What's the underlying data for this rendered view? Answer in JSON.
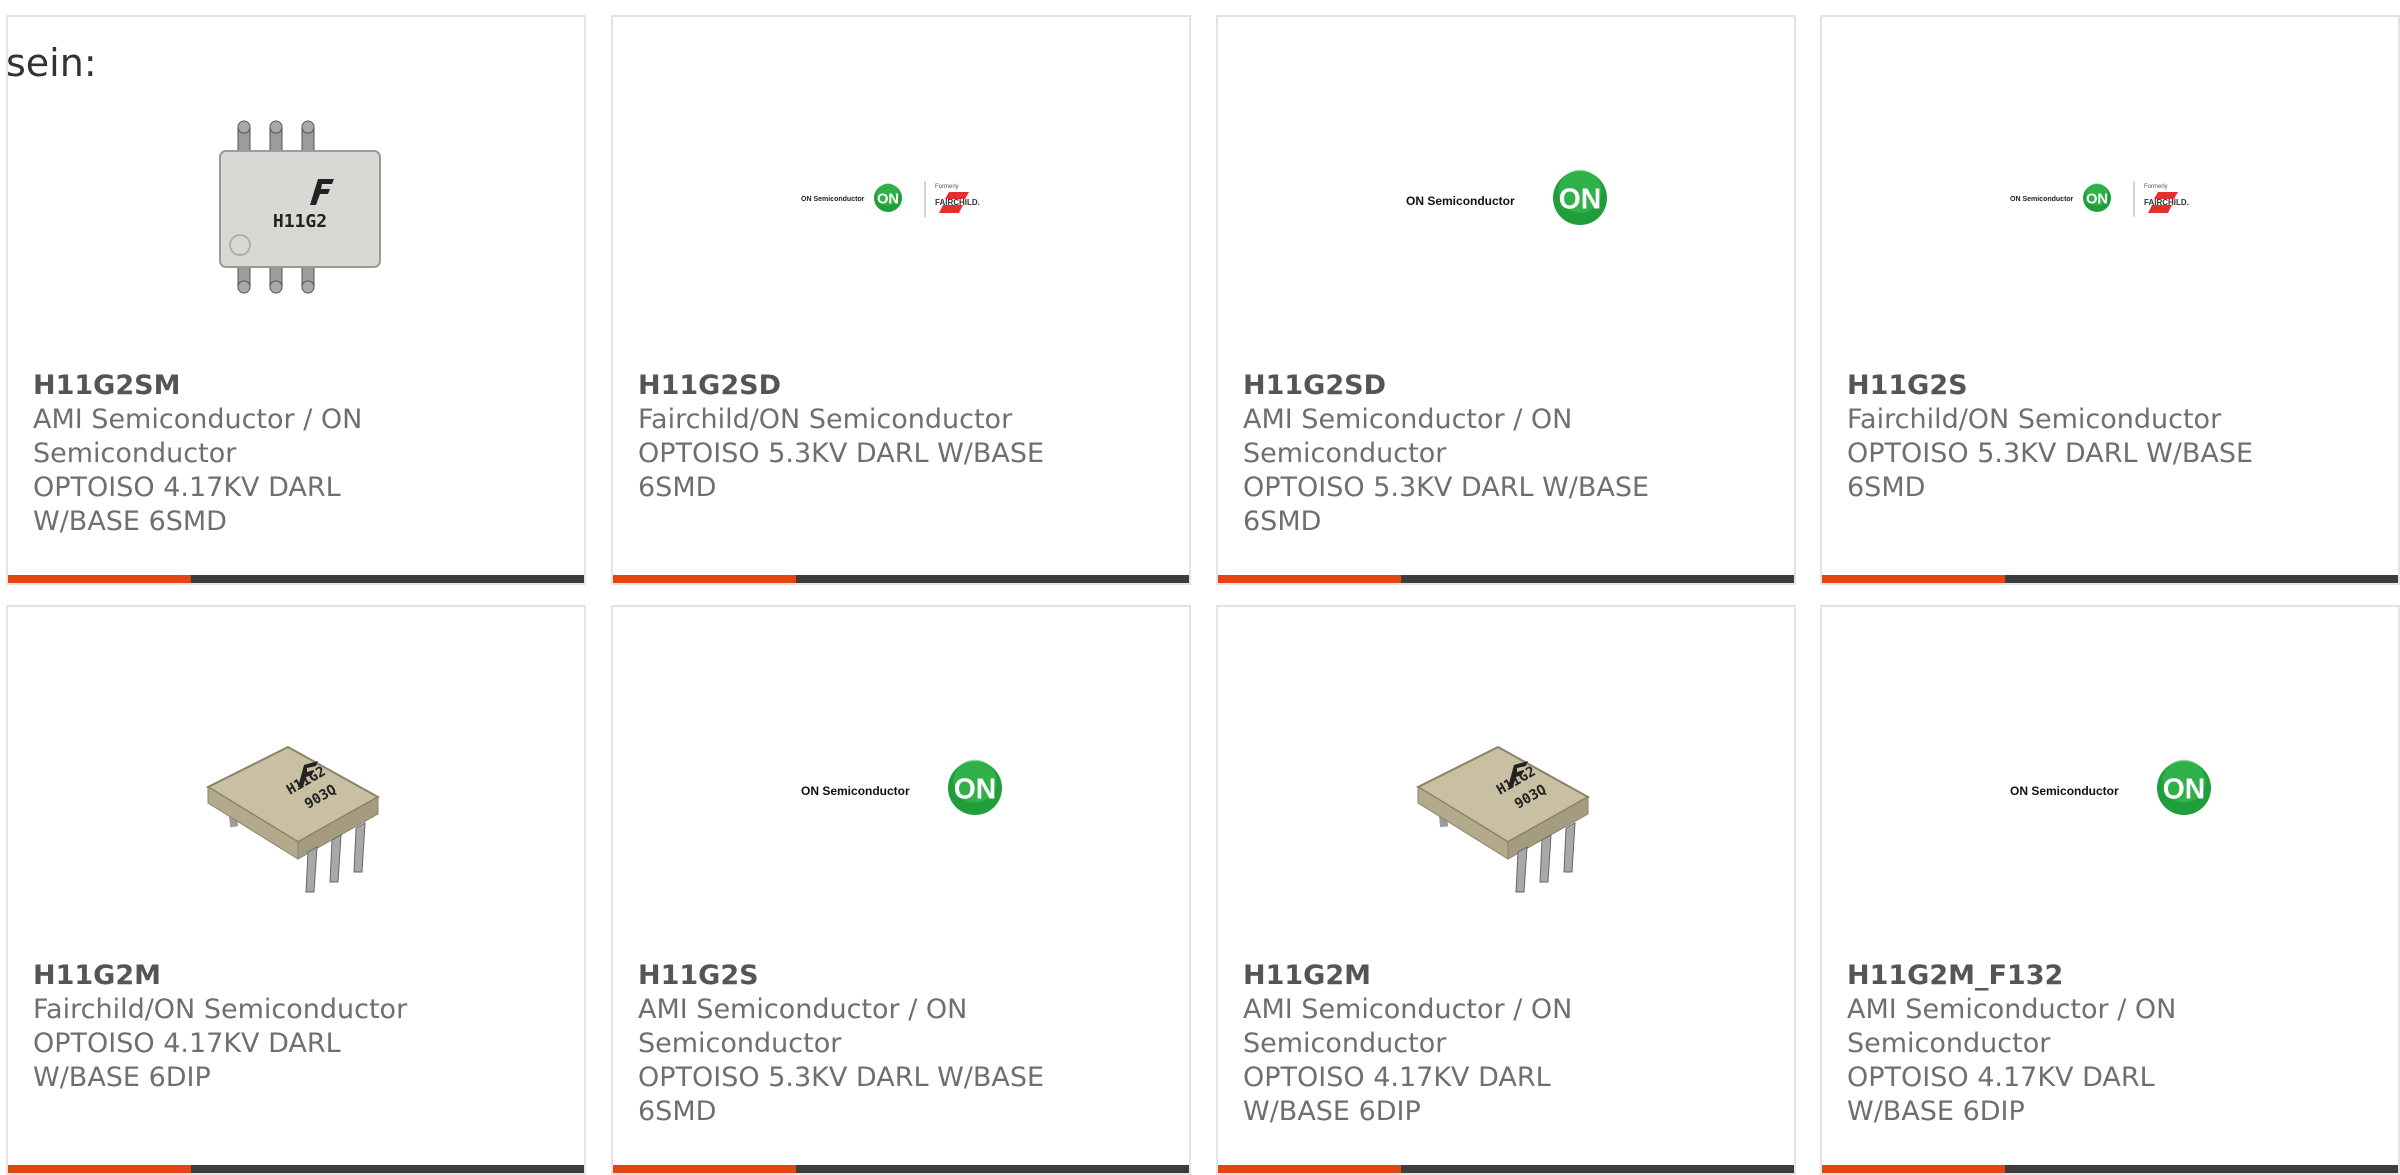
{
  "intro_text": "sein:",
  "accent_color": "#e2450d",
  "bar_color": "#3d3d3d",
  "logos": {
    "on_semi_text": "ON Semiconductor",
    "on_badge": "ON",
    "fairchild_formerly": "Formerly",
    "fairchild_text": "FAIRCHILD."
  },
  "chip_marking": {
    "smd": "H11G2",
    "dip_line1": "H11G2",
    "dip_line2": "903Q"
  },
  "cards": [
    {
      "part": "H11G2SM",
      "manufacturer": "AMI Semiconductor / ON Semiconductor",
      "description": "OPTOISO 4.17KV DARL W/BASE 6SMD",
      "image": "smd-chip"
    },
    {
      "part": "H11G2SD",
      "manufacturer": "Fairchild/ON Semiconductor",
      "description": "OPTOISO 5.3KV DARL W/BASE 6SMD",
      "image": "on-fairchild-logo"
    },
    {
      "part": "H11G2SD",
      "manufacturer": "AMI Semiconductor / ON Semiconductor",
      "description": "OPTOISO 5.3KV DARL W/BASE 6SMD",
      "image": "on-semi-logo"
    },
    {
      "part": "H11G2S",
      "manufacturer": "Fairchild/ON Semiconductor",
      "description": "OPTOISO 5.3KV DARL W/BASE 6SMD",
      "image": "on-fairchild-logo"
    },
    {
      "part": "H11G2M",
      "manufacturer": "Fairchild/ON Semiconductor",
      "description": "OPTOISO 4.17KV DARL W/BASE 6DIP",
      "image": "dip-chip"
    },
    {
      "part": "H11G2S",
      "manufacturer": "AMI Semiconductor / ON Semiconductor",
      "description": "OPTOISO 5.3KV DARL W/BASE 6SMD",
      "image": "on-semi-logo"
    },
    {
      "part": "H11G2M",
      "manufacturer": "AMI Semiconductor / ON Semiconductor",
      "description": "OPTOISO 4.17KV DARL W/BASE 6DIP",
      "image": "dip-chip"
    },
    {
      "part": "H11G2M_F132",
      "manufacturer": "AMI Semiconductor / ON Semiconductor",
      "description": "OPTOISO 4.17KV DARL W/BASE 6DIP",
      "image": "on-semi-logo"
    }
  ]
}
